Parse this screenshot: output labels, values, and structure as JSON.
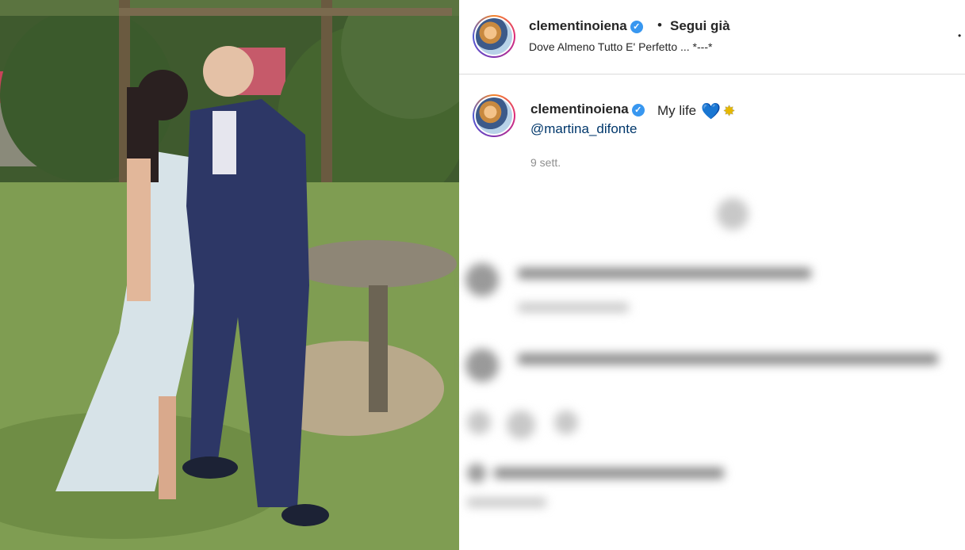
{
  "post": {
    "username": "clementinoiena",
    "verified_mark": "✓",
    "separator": "•",
    "follow_status": "Segui già",
    "audio": "Dove Almeno Tutto E' Perfetto ... *---*",
    "more": "•",
    "caption_text": "My life",
    "caption_emoji_1": "💙",
    "caption_emoji_2": "✸",
    "mention": "@martina_difonte",
    "date": "9 sett."
  },
  "colors": {
    "verified": "#3897f0",
    "mention": "#00376b",
    "muted": "#8e8e8e"
  },
  "icons": [
    "verified-badge-icon",
    "more-options-icon",
    "heart-emoji-icon",
    "sparkle-emoji-icon"
  ]
}
